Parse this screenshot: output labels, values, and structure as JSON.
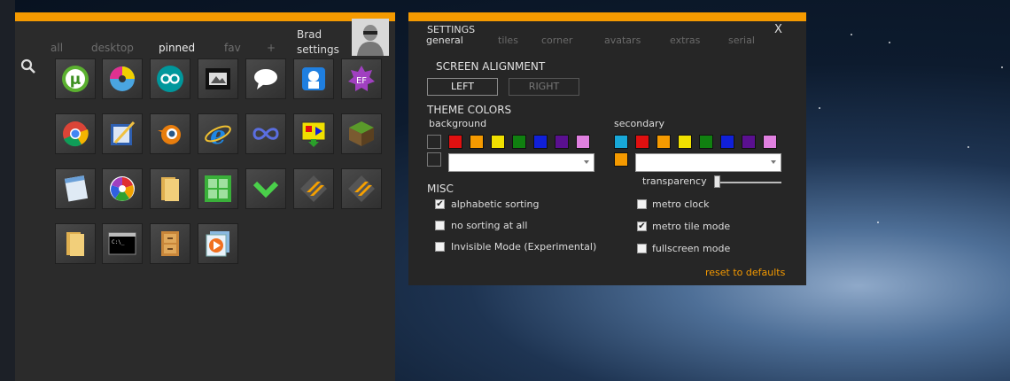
{
  "start_menu": {
    "tabs": [
      {
        "label": "all",
        "active": false
      },
      {
        "label": "desktop",
        "active": false
      },
      {
        "label": "pinned",
        "active": true
      },
      {
        "label": "fav",
        "active": false
      },
      {
        "label": "+",
        "active": false
      }
    ],
    "user": {
      "name": "Brad",
      "settings_label": "settings"
    },
    "accent_color": "#f59a00",
    "tiles": [
      {
        "icon": "utorrent-icon"
      },
      {
        "icon": "disc-burner-icon"
      },
      {
        "icon": "arduino-icon"
      },
      {
        "icon": "movie-maker-icon"
      },
      {
        "icon": "chat-bubble-icon"
      },
      {
        "icon": "finder-icon"
      },
      {
        "icon": "ef-app-icon"
      },
      {
        "icon": "chrome-icon"
      },
      {
        "icon": "pen-editor-icon"
      },
      {
        "icon": "blender-icon"
      },
      {
        "icon": "internet-explorer-icon"
      },
      {
        "icon": "infinity-icon"
      },
      {
        "icon": "download-display-icon"
      },
      {
        "icon": "minecraft-icon"
      },
      {
        "icon": "notepad-icon"
      },
      {
        "icon": "picasa-icon"
      },
      {
        "icon": "folder-icon"
      },
      {
        "icon": "green-tiles-icon"
      },
      {
        "icon": "green-chevron-icon"
      },
      {
        "icon": "winamp-icon"
      },
      {
        "icon": "winamp-icon"
      },
      {
        "icon": "folder-icon"
      },
      {
        "icon": "command-prompt-icon"
      },
      {
        "icon": "file-cabinet-icon"
      },
      {
        "icon": "media-player-icon"
      }
    ]
  },
  "settings": {
    "title": "SETTINGS",
    "close_label": "X",
    "tabs": [
      {
        "label": "general",
        "active": true
      },
      {
        "label": "tiles",
        "active": false
      },
      {
        "label": "corner",
        "active": false
      },
      {
        "label": "avatars",
        "active": false
      },
      {
        "label": "extras",
        "active": false
      },
      {
        "label": "serial",
        "active": false
      }
    ],
    "screen_alignment": {
      "heading": "SCREEN ALIGNMENT",
      "left_label": "LEFT",
      "right_label": "RIGHT",
      "selected": "LEFT"
    },
    "theme_colors": {
      "heading": "THEME COLORS",
      "background_label": "background",
      "secondary_label": "secondary",
      "background_swatches": [
        "empty",
        "#e01010",
        "#f59a00",
        "#f0e000",
        "#108010",
        "#1020d8",
        "#5a1090",
        "#e080e0"
      ],
      "secondary_swatches": [
        "#18a8d8",
        "#e01010",
        "#f59a00",
        "#f0e000",
        "#108010",
        "#1020d8",
        "#5a1090",
        "#e080e0",
        "#f59a00"
      ],
      "background_dropdown_value": "",
      "secondary_dropdown_value": "",
      "transparency_label": "transparency",
      "transparency_value": 0
    },
    "misc": {
      "heading": "MISC",
      "options": [
        {
          "label": "alphabetic sorting",
          "checked": true
        },
        {
          "label": "no sorting at all",
          "checked": false
        },
        {
          "label": "Invisible Mode (Experimental)",
          "checked": false
        },
        {
          "label": "metro clock",
          "checked": false
        },
        {
          "label": "metro tile mode",
          "checked": true
        },
        {
          "label": "fullscreen mode",
          "checked": false
        }
      ]
    },
    "reset_label": "reset to defaults"
  }
}
